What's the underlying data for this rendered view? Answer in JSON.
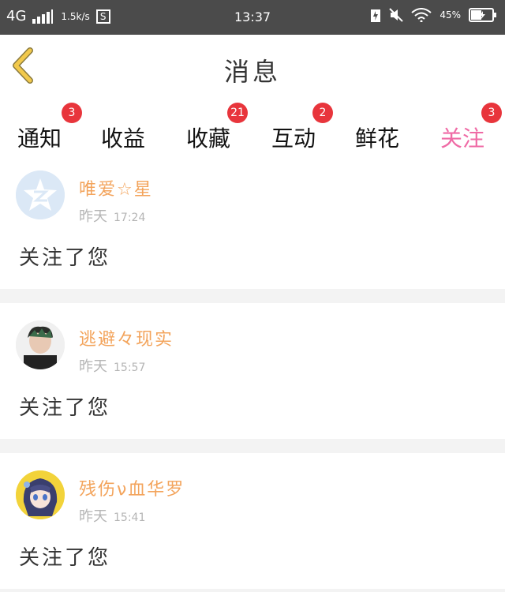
{
  "status_bar": {
    "network": "4G",
    "speed": "1.5k/s",
    "time": "13:37",
    "battery_text": "45%"
  },
  "header": {
    "title": "消息"
  },
  "tabs": [
    {
      "label": "通知",
      "badge": "3"
    },
    {
      "label": "收益",
      "badge": ""
    },
    {
      "label": "收藏",
      "badge": "21"
    },
    {
      "label": "互动",
      "badge": "2"
    },
    {
      "label": "鲜花",
      "badge": ""
    },
    {
      "label": "关注",
      "badge": "3",
      "active": true
    }
  ],
  "messages": [
    {
      "user": "唯爱☆星",
      "day": "昨天",
      "time": "17:24",
      "text": "关注了您"
    },
    {
      "user": "逃避々现实",
      "day": "昨天",
      "time": "15:57",
      "text": "关注了您"
    },
    {
      "user": "残伤ν血华罗",
      "day": "昨天",
      "time": "15:41",
      "text": "关注了您"
    }
  ],
  "colors": {
    "accent": "#ef6aa5",
    "badge": "#e8353c",
    "username": "#f3a45c",
    "back_icon": "#f2c94c"
  }
}
